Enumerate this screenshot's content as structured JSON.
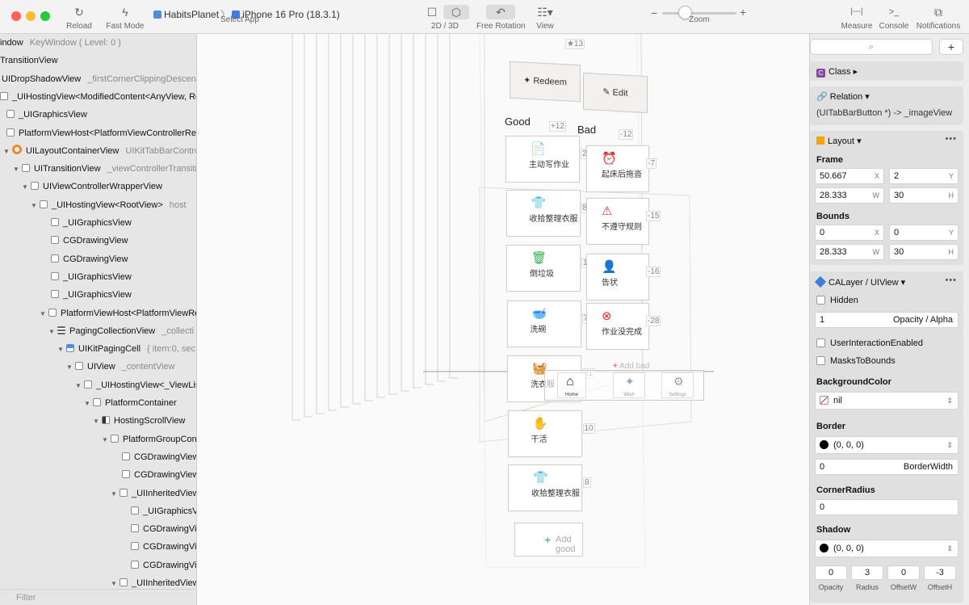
{
  "toolbar": {
    "reload": "Reload",
    "fast_mode": "Fast Mode",
    "app_name": "HabitsPlanet",
    "device": "iPhone 16 Pro (18.3.1)",
    "select_app": "Select App",
    "view_2d3d": "2D / 3D",
    "free_rotation": "Free Rotation",
    "view": "View",
    "zoom": "Zoom",
    "zoom_level": 0.3,
    "measure": "Measure",
    "console": "Console",
    "notifications": "Notifications"
  },
  "hierarchy": {
    "rows": [
      {
        "label": "indow",
        "extra": "KeyWindow ( Level: 0 )",
        "indent": 0,
        "tri": "",
        "icon": "none"
      },
      {
        "label": "TransitionView",
        "extra": "",
        "indent": 0,
        "tri": "",
        "icon": "none"
      },
      {
        "label": "UIDropShadowView",
        "extra": "_firstCornerClippingDescenda",
        "indent": 2,
        "tri": "",
        "icon": "none"
      },
      {
        "label": "_UIHostingView<ModifiedContent<AnyView, Roo",
        "extra": "",
        "indent": 0,
        "tri": "",
        "icon": "box"
      },
      {
        "label": "_UIGraphicsView",
        "extra": "",
        "indent": 8,
        "tri": "",
        "icon": "box"
      },
      {
        "label": "PlatformViewHost<PlatformViewControllerRep",
        "extra": "",
        "indent": 8,
        "tri": "",
        "icon": "box"
      },
      {
        "label": "UILayoutContainerView",
        "extra": "UIKitTabBarControl",
        "indent": 4,
        "tri": "▼",
        "icon": "orange"
      },
      {
        "label": "UITransitionView",
        "extra": "_viewControllerTransitio",
        "indent": 16,
        "tri": "▼",
        "icon": "box"
      },
      {
        "label": "UIViewControllerWrapperView",
        "extra": "",
        "indent": 27,
        "tri": "▼",
        "icon": "box"
      },
      {
        "label": "_UIHostingView<RootView>",
        "extra": "host",
        "indent": 38,
        "tri": "▼",
        "icon": "box"
      },
      {
        "label": "_UIGraphicsView",
        "extra": "",
        "indent": 63,
        "tri": "",
        "icon": "box"
      },
      {
        "label": "CGDrawingView",
        "extra": "",
        "indent": 63,
        "tri": "",
        "icon": "box"
      },
      {
        "label": "CGDrawingView",
        "extra": "",
        "indent": 63,
        "tri": "",
        "icon": "box"
      },
      {
        "label": "_UIGraphicsView",
        "extra": "",
        "indent": 63,
        "tri": "",
        "icon": "box"
      },
      {
        "label": "_UIGraphicsView",
        "extra": "",
        "indent": 63,
        "tri": "",
        "icon": "box"
      },
      {
        "label": "PlatformViewHost<PlatformViewRe",
        "extra": "",
        "indent": 49,
        "tri": "▼",
        "icon": "box"
      },
      {
        "label": "PagingCollectionView",
        "extra": "_collecti",
        "indent": 60,
        "tri": "▼",
        "icon": "grid"
      },
      {
        "label": "UIKitPagingCell",
        "extra": "{ item:0, sec:",
        "indent": 71,
        "tri": "▼",
        "icon": "blue"
      },
      {
        "label": "UIView",
        "extra": "_contentView",
        "indent": 82,
        "tri": "▼",
        "icon": "box"
      },
      {
        "label": "_UIHostingView<_ViewLis",
        "extra": "",
        "indent": 93,
        "tri": "▼",
        "icon": "box"
      },
      {
        "label": "PlatformContainer",
        "extra": "",
        "indent": 104,
        "tri": "▼",
        "icon": "box"
      },
      {
        "label": "HostingScrollView",
        "extra": "",
        "indent": 115,
        "tri": "▼",
        "icon": "half"
      },
      {
        "label": "PlatformGroupCon",
        "extra": "",
        "indent": 126,
        "tri": "▼",
        "icon": "box"
      },
      {
        "label": "CGDrawingView",
        "extra": "",
        "indent": 151,
        "tri": "",
        "icon": "box"
      },
      {
        "label": "CGDrawingView",
        "extra": "",
        "indent": 151,
        "tri": "",
        "icon": "box"
      },
      {
        "label": "_UIInheritedView",
        "extra": "",
        "indent": 137,
        "tri": "▼",
        "icon": "box"
      },
      {
        "label": "_UIGraphicsV",
        "extra": "",
        "indent": 162,
        "tri": "",
        "icon": "box"
      },
      {
        "label": "CGDrawingVie",
        "extra": "",
        "indent": 162,
        "tri": "",
        "icon": "box"
      },
      {
        "label": "CGDrawingVie",
        "extra": "",
        "indent": 162,
        "tri": "",
        "icon": "box"
      },
      {
        "label": "CGDrawingVie",
        "extra": "",
        "indent": 162,
        "tri": "",
        "icon": "box"
      },
      {
        "label": "_UIInheritedView",
        "extra": "",
        "indent": 137,
        "tri": "▼",
        "icon": "box"
      }
    ],
    "filter_placeholder": "Filter"
  },
  "canvas": {
    "top_badge": "13",
    "redeem": "Redeem",
    "edit": "Edit",
    "good_title": "Good",
    "good_score": "+12",
    "bad_title": "Bad",
    "bad_score": "-12",
    "good_items": [
      {
        "label": "主动写作业",
        "badge": "24",
        "icon": "📄"
      },
      {
        "label": "收拾整理衣服",
        "badge": "8",
        "icon": "👕"
      },
      {
        "label": "倒垃圾",
        "badge": "12",
        "icon": "🗑"
      },
      {
        "label": "洗碗",
        "badge": "7",
        "icon": "🥣"
      },
      {
        "label": "洗衣服",
        "badge": "21",
        "icon": "🧺"
      },
      {
        "label": "干活",
        "badge": "10",
        "icon": "✋"
      },
      {
        "label": "收拾整理衣服",
        "badge": "8",
        "icon": "👕"
      }
    ],
    "bad_items": [
      {
        "label": "起床后拖沓",
        "badge": "-7",
        "icon": "⏰"
      },
      {
        "label": "不遵守规则",
        "badge": "-15",
        "icon": "⚠"
      },
      {
        "label": "告状",
        "badge": "-16",
        "icon": "👤"
      },
      {
        "label": "作业没完成",
        "badge": "-28",
        "icon": "⊗"
      }
    ],
    "add_good": "Add good",
    "add_bad": "Add bad",
    "tabbar": [
      {
        "label": "Home"
      },
      {
        "label": "Wish"
      },
      {
        "label": "Settings"
      }
    ]
  },
  "inspector": {
    "class_title": "Class",
    "relation_title": "Relation",
    "relation_value": "(UITabBarButton *) -> _imageView",
    "layout_title": "Layout",
    "frame_label": "Frame",
    "frame": {
      "x": "50.667",
      "y": "2",
      "w": "28.333",
      "h": "30"
    },
    "bounds_label": "Bounds",
    "bounds": {
      "x": "0",
      "y": "0",
      "w": "28.333",
      "h": "30"
    },
    "calayer_title": "CALayer / UIView",
    "hidden_label": "Hidden",
    "opacity_value": "1",
    "opacity_label": "Opacity / Alpha",
    "user_interaction": "UserInteractionEnabled",
    "masks_to_bounds": "MasksToBounds",
    "bg_color_label": "BackgroundColor",
    "bg_color_value": "nil",
    "border_label": "Border",
    "border_color": "(0, 0, 0)",
    "border_width_value": "0",
    "border_width_label": "BorderWidth",
    "corner_radius_label": "CornerRadius",
    "corner_radius_value": "0",
    "shadow_label": "Shadow",
    "shadow_color": "(0, 0, 0)",
    "shadow_fields": [
      {
        "value": "0",
        "label": "Opacity"
      },
      {
        "value": "3",
        "label": "Radius"
      },
      {
        "value": "0",
        "label": "OffsetW"
      },
      {
        "value": "-3",
        "label": "OffsetH"
      }
    ],
    "axis": {
      "x": "X",
      "y": "Y",
      "w": "W",
      "h": "H"
    }
  },
  "colors": {
    "accent_purple": "#8e44ad",
    "layout_orange": "#f0a500",
    "layer_blue": "#3f7fd6",
    "green_icon": "#2fae4e",
    "red_icon": "#e03131"
  }
}
